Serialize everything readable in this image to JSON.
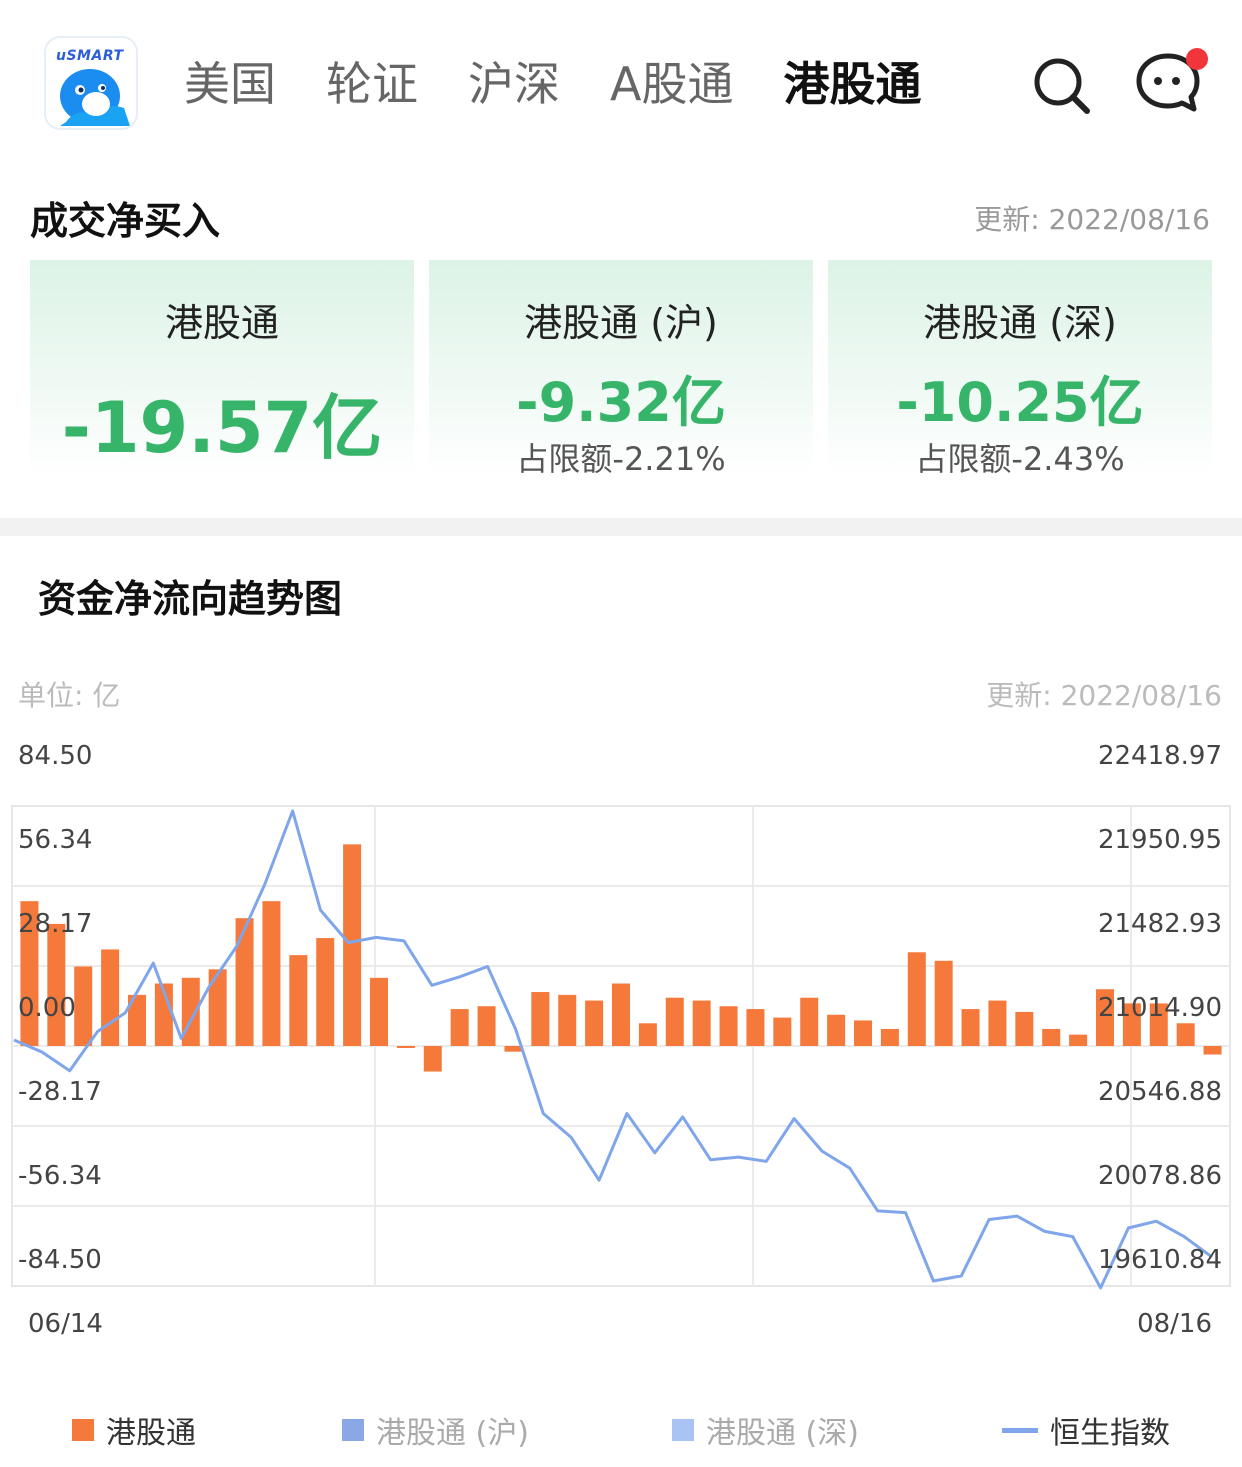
{
  "nav": {
    "logo_text": "uSMART",
    "tabs": [
      {
        "label": "美国",
        "active": false
      },
      {
        "label": "轮证",
        "active": false
      },
      {
        "label": "沪深",
        "active": false
      },
      {
        "label": "A股通",
        "active": false
      },
      {
        "label": "港股通",
        "active": true
      }
    ],
    "icons": [
      "search-icon",
      "message-icon"
    ],
    "notification_dot_color": "#f2353a"
  },
  "net_buy": {
    "title": "成交净买入",
    "update": "更新: 2022/08/16",
    "cards": [
      {
        "label": "港股通",
        "value": "-19.57亿",
        "ratio": ""
      },
      {
        "label": "港股通 (沪)",
        "value": "-9.32亿",
        "ratio": "占限额-2.21%"
      },
      {
        "label": "港股通 (深)",
        "value": "-10.25亿",
        "ratio": "占限额-2.43%"
      }
    ],
    "value_color": "#36b46a"
  },
  "trend": {
    "title": "资金净流向趋势图",
    "unit": "单位: 亿",
    "update": "更新: 2022/08/16"
  },
  "chart_data": {
    "type": "bar",
    "left_ticks": [
      "84.50",
      "56.34",
      "28.17",
      "0.00",
      "-28.17",
      "-56.34",
      "-84.50"
    ],
    "right_ticks": [
      "22418.97",
      "21950.95",
      "21482.93",
      "21014.90",
      "20546.88",
      "20078.86",
      "19610.84"
    ],
    "ylim": [
      -84.5,
      84.5
    ],
    "y2lim": [
      19610.84,
      22418.97
    ],
    "x_labels": [
      "06/14",
      "08/16"
    ],
    "grid": true,
    "series": [
      {
        "name": "港股通",
        "type": "bar",
        "color": "#f5793a",
        "values": [
          51,
          43,
          28,
          34,
          18,
          22,
          24,
          27,
          45,
          51,
          32,
          38,
          71,
          24,
          -0.5,
          -9,
          13,
          14,
          -2,
          19,
          18,
          16,
          22,
          8,
          17,
          16,
          14,
          13,
          10,
          17,
          11,
          9,
          6,
          33,
          30,
          13,
          16,
          12,
          6,
          4,
          20,
          15,
          15,
          8,
          -3
        ]
      },
      {
        "name": "恒生指数",
        "type": "line",
        "color": "#7fa5ea",
        "values": [
          21050,
          20980,
          20870,
          21100,
          21210,
          21500,
          21060,
          21360,
          21600,
          21960,
          22390,
          21810,
          21620,
          21650,
          21630,
          21370,
          21420,
          21480,
          21115,
          20620,
          20480,
          20230,
          20620,
          20390,
          20600,
          20350,
          20365,
          20340,
          20590,
          20400,
          20300,
          20050,
          20040,
          19640,
          19670,
          20000,
          20020,
          19930,
          19900,
          19600,
          19950,
          19990,
          19900,
          19780
        ]
      }
    ],
    "legend": [
      {
        "name": "港股通",
        "color": "#f5793a",
        "shape": "square"
      },
      {
        "name": "港股通 (沪)",
        "color": "#8aa7e6",
        "shape": "square"
      },
      {
        "name": "港股通 (深)",
        "color": "#a9c3f5",
        "shape": "square"
      },
      {
        "name": "恒生指数",
        "color": "#7fa5ea",
        "shape": "line"
      }
    ]
  }
}
